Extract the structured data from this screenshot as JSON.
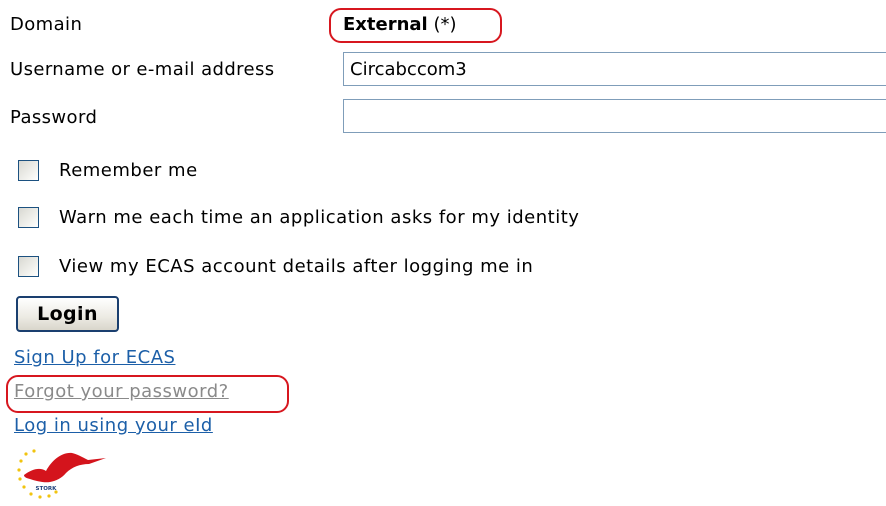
{
  "form": {
    "domain_label": "Domain",
    "domain_value": "External",
    "domain_note": "(*)",
    "username_label": "Username or e-mail address",
    "username_value": "Circabccom3",
    "password_label": "Password",
    "password_value": ""
  },
  "options": [
    {
      "label": "Remember me",
      "checked": false
    },
    {
      "label": "Warn me each time an application asks for my identity",
      "checked": false
    },
    {
      "label": "View my ECAS account details after logging me in",
      "checked": false
    }
  ],
  "login_button": "Login",
  "links": {
    "sign_up": "Sign Up for ECAS",
    "forgot_password": "Forgot your password?",
    "eid_login": "Log in using your eId"
  },
  "logo": {
    "name": "stork-logo",
    "text": "STORK"
  },
  "colors": {
    "highlight": "#d7171f",
    "link": "#1c5fa8",
    "visited_link": "#8a8a8a",
    "field_border": "#7f9db9"
  }
}
